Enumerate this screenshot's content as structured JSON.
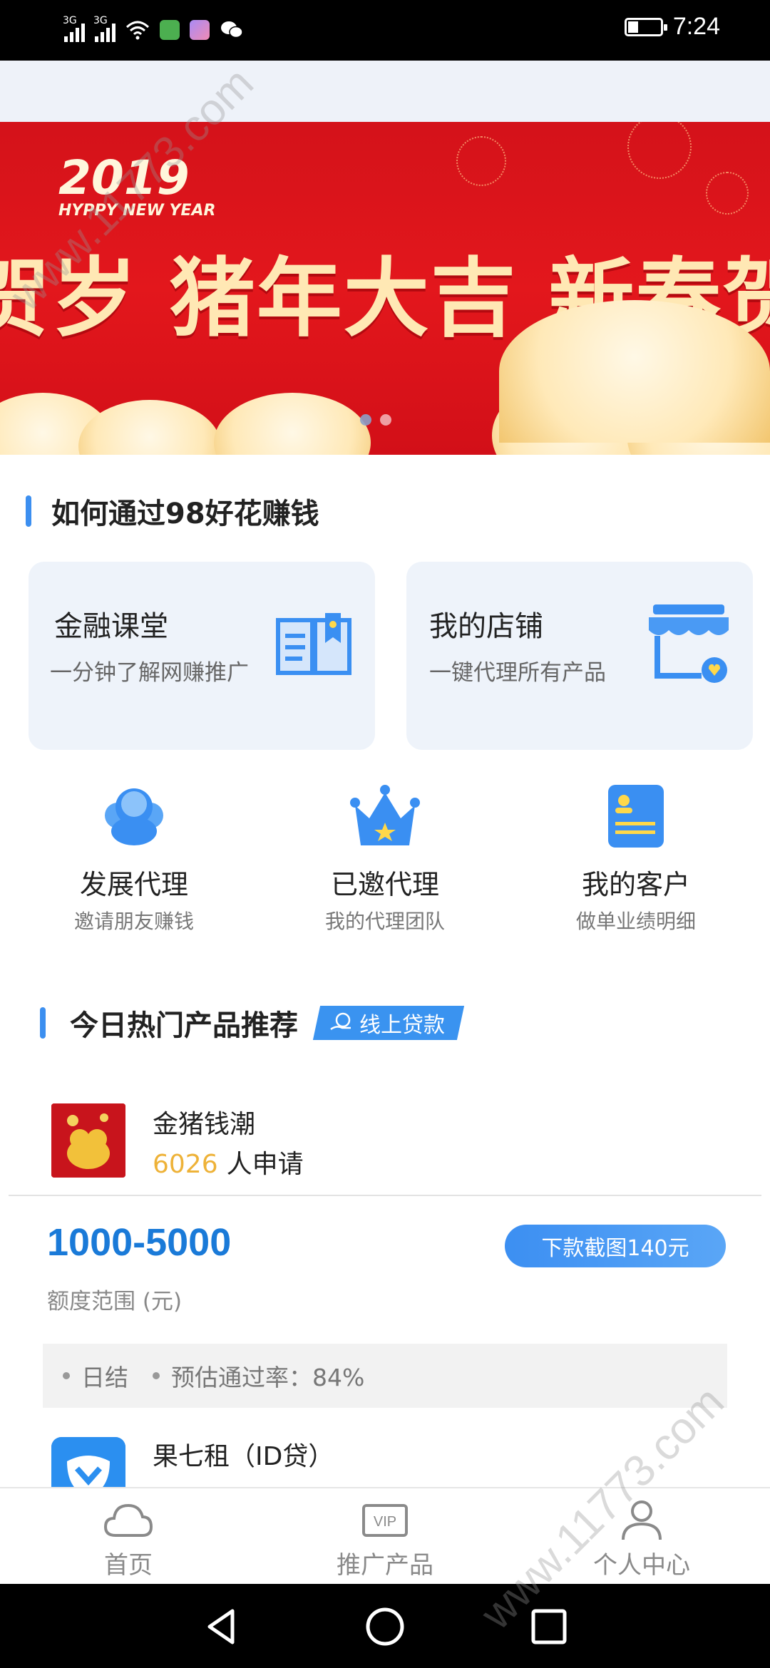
{
  "status_bar": {
    "network_1": "3G",
    "network_2": "3G",
    "time": "7:24",
    "battery_level": 0.3
  },
  "banner": {
    "year": "2019",
    "subtitle": "HYPPY NEW YEAR",
    "slogan": "贺岁 猪年大吉 新春贺",
    "indicator_count": 2,
    "active_index": 0
  },
  "how_to_earn": {
    "title": "如何通过98好花赚钱",
    "cards": [
      {
        "title": "金融课堂",
        "desc": "一分钟了解网赚推广",
        "icon": "book-icon"
      },
      {
        "title": "我的店铺",
        "desc": "一键代理所有产品",
        "icon": "store-icon"
      }
    ],
    "entries": [
      {
        "title": "发展代理",
        "desc": "邀请朋友赚钱",
        "icon": "agent-people-icon"
      },
      {
        "title": "已邀代理",
        "desc": "我的代理团队",
        "icon": "crown-icon"
      },
      {
        "title": "我的客户",
        "desc": "做单业绩明细",
        "icon": "customer-card-icon"
      }
    ]
  },
  "hot_products": {
    "title": "今日热门产品推荐",
    "tag": "线上贷款",
    "products": [
      {
        "name": "金猪钱潮",
        "apply_count": "6026",
        "apply_suffix": "人申请",
        "amount_range": "1000-5000",
        "amount_label": "额度范围 (元)",
        "button": "下款截图140元",
        "info_1": "日结",
        "info_2": "预估通过率：84%"
      },
      {
        "name": "果七租（ID贷）"
      }
    ]
  },
  "bottom_nav": {
    "items": [
      {
        "label": "首页",
        "icon": "cloud-icon"
      },
      {
        "label": "推广产品",
        "icon": "vip-icon"
      },
      {
        "label": "个人中心",
        "icon": "person-icon"
      }
    ]
  },
  "watermark": "www.11773.com",
  "colors": {
    "accent": "#3c8ff0",
    "amount": "#1a7ad8",
    "apply_count": "#eeb238",
    "banner": "#d4121a"
  }
}
